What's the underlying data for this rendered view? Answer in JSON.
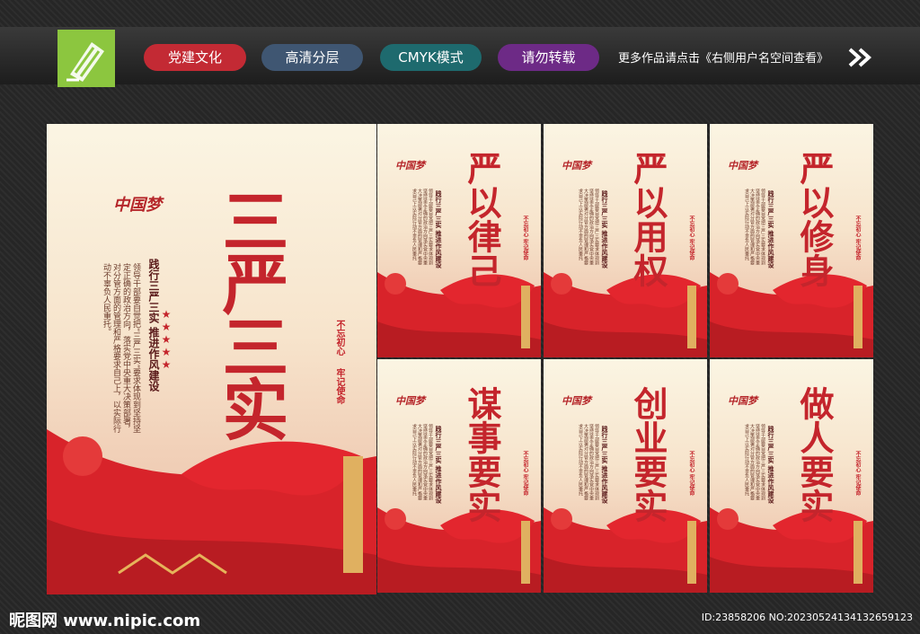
{
  "header": {
    "tags": [
      "党建文化",
      "高清分层",
      "CMYK模式",
      "请勿转载"
    ],
    "more_text": "更多作品请点击《右侧用户名空间查看》"
  },
  "main_poster": {
    "title": "三严三实",
    "mark": "中国梦",
    "slogan": "践行三严三实 推进作风建设",
    "body": "领导干部要自觉把“三严三实”要求体现到坚持坚定正确的政治方向，落实党中央重大决策部署，对分管方面的管理和严格要求自己上，以实际行动不辜负人民重托。",
    "motto_a": "不忘初心",
    "motto_b": "牢记使命"
  },
  "small_posters": [
    {
      "title": "严以律己"
    },
    {
      "title": "严以用权"
    },
    {
      "title": "严以修身"
    },
    {
      "title": "谋事要实"
    },
    {
      "title": "创业要实"
    },
    {
      "title": "做人要实"
    }
  ],
  "small_common": {
    "mark": "中国梦",
    "slogan": "践行三严三实 推进作风建设",
    "body": "领导干部要自觉把三严三实要求体现到坚持坚定正确的政治方向落实党中央重大决策部署对分管方面的管理和严格要求自己上以实际行动不辜负人民重托",
    "motto": "不忘初心 牢记使命"
  },
  "footer": {
    "site": "昵图网 www.nipic.com",
    "id": "ID:23858206 NO:20230524134132659123"
  },
  "colors": {
    "accent_red": "#c4252c",
    "gold": "#d8a24a"
  }
}
